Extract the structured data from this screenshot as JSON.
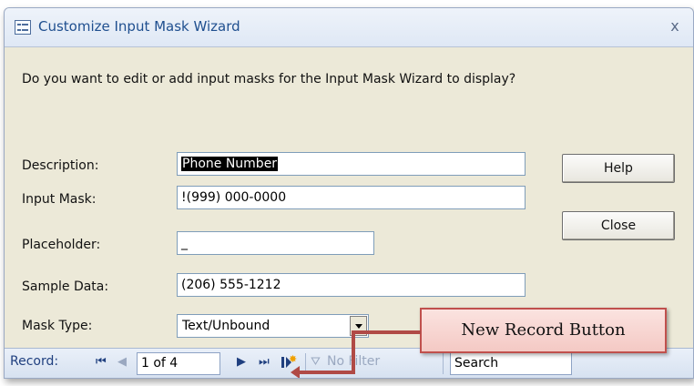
{
  "window": {
    "title": "Customize Input Mask Wizard",
    "close_glyph": "x"
  },
  "prompt": "Do you want to edit or add input masks for the Input Mask Wizard to display?",
  "form": {
    "description_label": "Description:",
    "description_value": "Phone Number",
    "input_mask_label": "Input Mask:",
    "input_mask_value": "!(999) 000-0000",
    "placeholder_label": "Placeholder:",
    "placeholder_value": "_",
    "sample_data_label": "Sample Data:",
    "sample_data_value": "(206) 555-1212",
    "mask_type_label": "Mask Type:",
    "mask_type_value": "Text/Unbound"
  },
  "buttons": {
    "help": "Help",
    "close": "Close"
  },
  "record_nav": {
    "label": "Record:",
    "first_glyph": "⏮",
    "prev_glyph": "◀",
    "position": "1 of 4",
    "next_glyph": "▶",
    "last_glyph": "⏭",
    "filter_glyph": "⛛",
    "filter_label": "No Filter",
    "search_label": "Search"
  },
  "annotation": {
    "text": "New Record Button",
    "color": "#c0504d"
  }
}
